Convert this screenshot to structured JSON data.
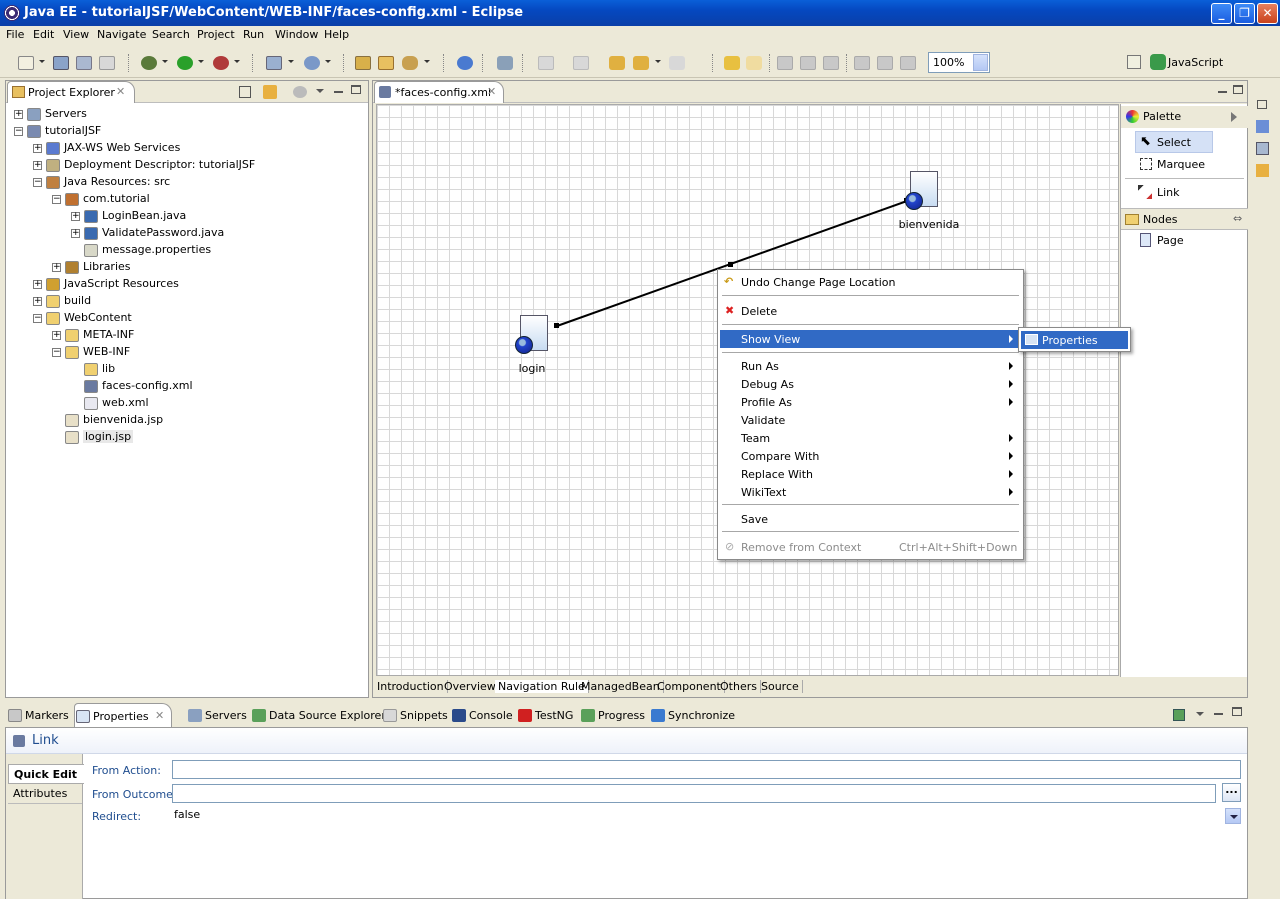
{
  "window": {
    "title": "Java EE - tutorialJSF/WebContent/WEB-INF/faces-config.xml - Eclipse",
    "controls": [
      "_",
      "❐",
      "✕"
    ]
  },
  "menubar": [
    "File",
    "Edit",
    "View",
    "Navigate",
    "Search",
    "Project",
    "Run",
    "Window",
    "Help"
  ],
  "toolbar": {
    "zoom": "100%",
    "perspective": "JavaScript"
  },
  "project_explorer": {
    "title": "Project Explorer",
    "tree": [
      {
        "label": "Servers",
        "depth": 0,
        "expander": "+",
        "icon": "folder-server-icon"
      },
      {
        "label": "tutorialJSF",
        "depth": 0,
        "expander": "−",
        "icon": "web-project-icon"
      },
      {
        "label": "JAX-WS Web Services",
        "depth": 1,
        "expander": "+",
        "icon": "webservice-icon"
      },
      {
        "label": "Deployment Descriptor: tutorialJSF",
        "depth": 1,
        "expander": "+",
        "icon": "descriptor-icon"
      },
      {
        "label": "Java Resources: src",
        "depth": 1,
        "expander": "−",
        "icon": "java-resources-icon"
      },
      {
        "label": "com.tutorial",
        "depth": 2,
        "expander": "−",
        "icon": "package-icon"
      },
      {
        "label": "LoginBean.java",
        "depth": 3,
        "expander": "+",
        "icon": "java-file-icon"
      },
      {
        "label": "ValidatePassword.java",
        "depth": 3,
        "expander": "+",
        "icon": "java-file-icon"
      },
      {
        "label": "message.properties",
        "depth": 3,
        "expander": "",
        "icon": "properties-file-icon"
      },
      {
        "label": "Libraries",
        "depth": 2,
        "expander": "+",
        "icon": "libraries-icon"
      },
      {
        "label": "JavaScript Resources",
        "depth": 1,
        "expander": "+",
        "icon": "js-resources-icon"
      },
      {
        "label": "build",
        "depth": 1,
        "expander": "+",
        "icon": "folder-icon"
      },
      {
        "label": "WebContent",
        "depth": 1,
        "expander": "−",
        "icon": "folder-icon"
      },
      {
        "label": "META-INF",
        "depth": 2,
        "expander": "+",
        "icon": "folder-icon"
      },
      {
        "label": "WEB-INF",
        "depth": 2,
        "expander": "−",
        "icon": "folder-icon"
      },
      {
        "label": "lib",
        "depth": 3,
        "expander": "",
        "icon": "folder-icon"
      },
      {
        "label": "faces-config.xml",
        "depth": 3,
        "expander": "",
        "icon": "faces-config-icon"
      },
      {
        "label": "web.xml",
        "depth": 3,
        "expander": "",
        "icon": "xml-file-icon"
      },
      {
        "label": "bienvenida.jsp",
        "depth": 2,
        "expander": "",
        "icon": "jsp-file-icon"
      },
      {
        "label": "login.jsp",
        "depth": 2,
        "expander": "",
        "icon": "jsp-file-icon"
      }
    ]
  },
  "editor": {
    "tab_title": "*faces-config.xml",
    "nodes": [
      {
        "label": "bienvenida"
      },
      {
        "label": "login"
      }
    ],
    "bottom_tabs": [
      "Introduction",
      "Overview",
      "Navigation Rule",
      "ManagedBean",
      "Component",
      "Others",
      "Source"
    ],
    "active_bottom_tab": "Navigation Rule"
  },
  "palette": {
    "title": "Palette",
    "tools": [
      "Select",
      "Marquee",
      "Link"
    ],
    "nodes_drawer": "Nodes",
    "node_items": [
      "Page"
    ]
  },
  "context_menu": {
    "undo": "Undo Change Page Location",
    "delete": "Delete",
    "show_view": "Show View",
    "run_as": "Run As",
    "debug_as": "Debug As",
    "profile_as": "Profile As",
    "validate": "Validate",
    "team": "Team",
    "compare_with": "Compare With",
    "replace_with": "Replace With",
    "wikitext": "WikiText",
    "save": "Save",
    "remove_from_context": "Remove from Context",
    "remove_shortcut": "Ctrl+Alt+Shift+Down",
    "submenu_properties": "Properties"
  },
  "bottom_views": {
    "tabs": [
      "Markers",
      "Properties",
      "Servers",
      "Data Source Explorer",
      "Snippets",
      "Console",
      "TestNG",
      "Progress",
      "Synchronize"
    ],
    "active_tab": "Properties"
  },
  "properties": {
    "title": "Link",
    "side_tabs": [
      "Quick Edit",
      "Attributes"
    ],
    "from_action_label": "From Action:",
    "from_action_value": "",
    "from_outcome_label": "From Outcome:",
    "from_outcome_value": "",
    "browse_button": "...",
    "redirect_label": "Redirect:",
    "redirect_value": "false"
  }
}
